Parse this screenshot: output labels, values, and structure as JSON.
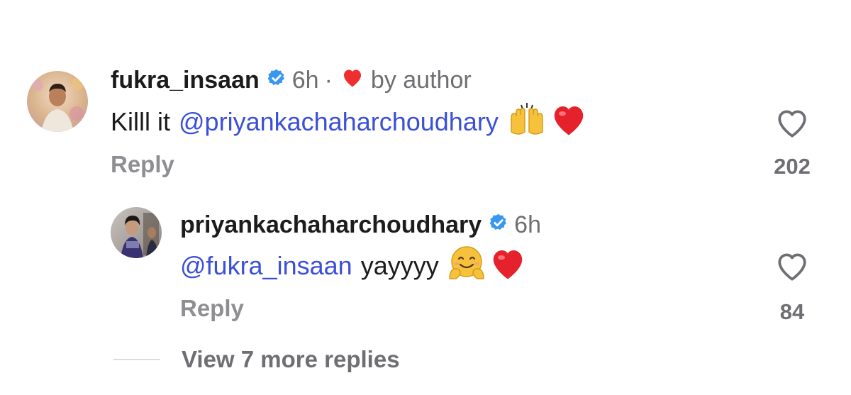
{
  "comments": [
    {
      "username": "fukra_insaan",
      "verified": true,
      "time": "6h",
      "separator": "·",
      "liked_by_author_label": "by author",
      "text_plain": "Killl it",
      "mention": "@priyankachaharchoudhary",
      "emojis": [
        "raising-hands-emoji",
        "red-heart-emoji"
      ],
      "reply_label": "Reply",
      "like_count": "202",
      "avatar_icon": "avatar-fukra-insaan"
    },
    {
      "username": "priyankachaharchoudhary",
      "verified": true,
      "time": "6h",
      "mention": "@fukra_insaan",
      "text_plain": "yayyyy",
      "emojis": [
        "hugging-face-emoji",
        "red-heart-emoji"
      ],
      "reply_label": "Reply",
      "like_count": "84",
      "avatar_icon": "avatar-priyanka"
    }
  ],
  "view_more_replies": "View 7 more replies",
  "colors": {
    "mention": "#3b4fd8",
    "verified": "#3897f0",
    "heart": "#ed2f2f",
    "secondary_text": "#6e6e73"
  }
}
